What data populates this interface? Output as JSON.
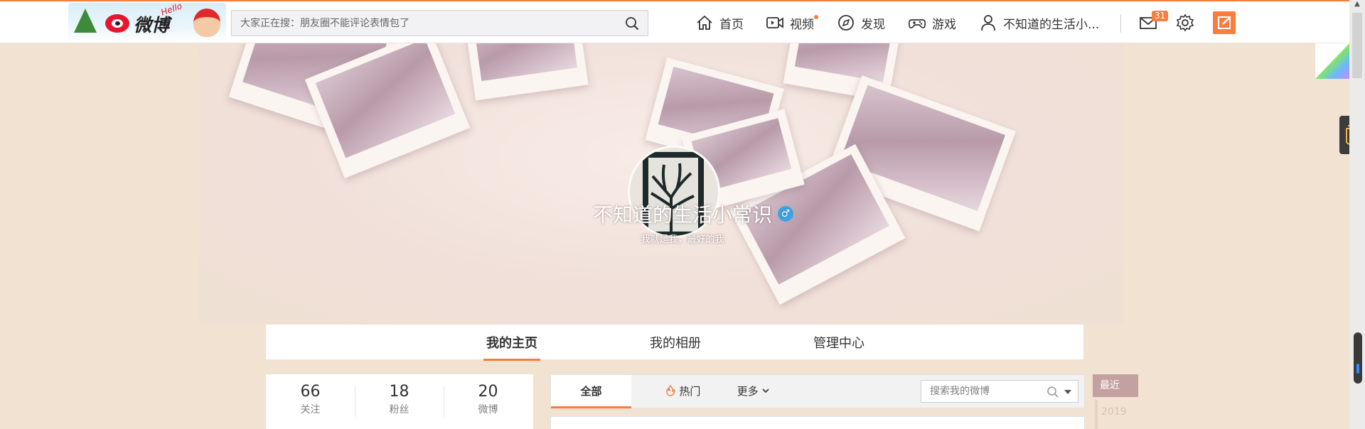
{
  "header": {
    "logo_text": "微博",
    "logo_tagline": "Hello",
    "search_placeholder": "大家正在搜：朋友圈不能评论表情包了",
    "nav": {
      "home": "首页",
      "video": "视频",
      "discover": "发现",
      "games": "游戏",
      "user": "不知道的生活小..."
    },
    "message_count": "31"
  },
  "profile": {
    "name": "不知道的生活小常识",
    "gender_symbol": "♂",
    "bio": "我就是我，最好的我"
  },
  "tabs": {
    "home": "我的主页",
    "album": "我的相册",
    "manage": "管理中心"
  },
  "stats": {
    "following": {
      "count": "66",
      "label": "关注"
    },
    "followers": {
      "count": "18",
      "label": "粉丝"
    },
    "weibo": {
      "count": "20",
      "label": "微博"
    }
  },
  "feed": {
    "tab_all": "全部",
    "tab_hot": "热门",
    "tab_more": "更多",
    "search_placeholder": "搜索我的微博"
  },
  "timeline": {
    "recent": "最近",
    "year": "2019"
  },
  "colors": {
    "accent": "#fa7d3c",
    "background": "#f1e2d1",
    "timeline_active": "#c4a1a1"
  }
}
